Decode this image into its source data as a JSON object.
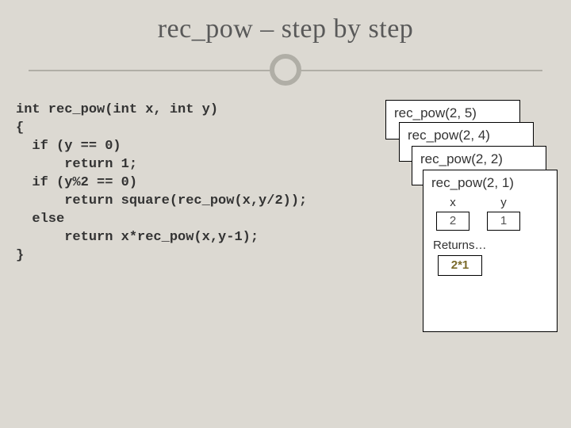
{
  "title": "rec_pow – step by step",
  "code": "int rec_pow(int x, int y)\n{\n  if (y == 0)\n      return 1;\n  if (y%2 == 0)\n      return square(rec_pow(x,y/2));\n  else\n      return x*rec_pow(x,y-1);\n}",
  "stack": {
    "frames": [
      {
        "title": "rec_pow(2, 5)"
      },
      {
        "title": "rec_pow(2, 4)"
      },
      {
        "title": "rec_pow(2, 2)"
      },
      {
        "title": "rec_pow(2, 1)"
      }
    ],
    "top": {
      "x_label": "x",
      "y_label": "y",
      "x_value": "2",
      "y_value": "1",
      "returns_label": "Returns…",
      "returns_value": "2*1"
    }
  }
}
